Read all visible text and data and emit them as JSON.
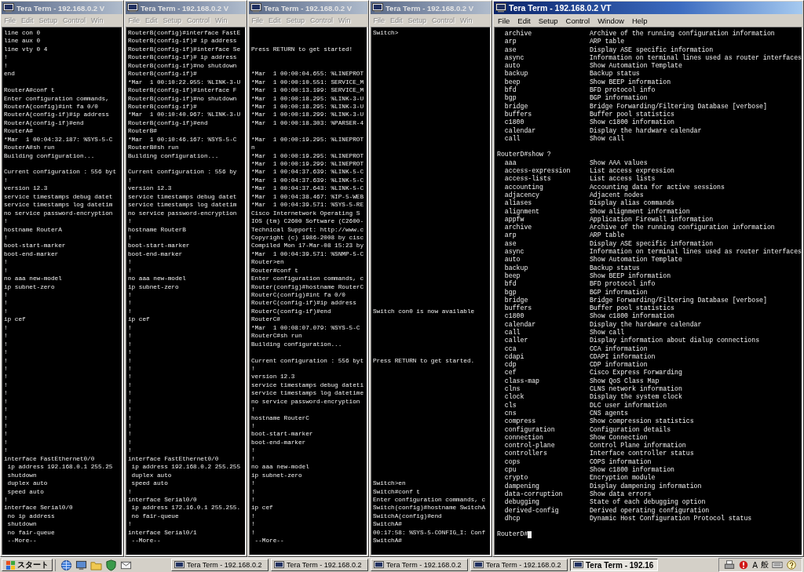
{
  "windows": [
    {
      "title": "Tera Term - 192.168.0.2 V",
      "active": false,
      "kind": "narrow",
      "menu": [
        "File",
        "Edit",
        "Setup",
        "Control",
        "Win"
      ],
      "lines": [
        {
          "kind": "text",
          "text": "line con 0"
        },
        {
          "kind": "text",
          "text": "line aux 0"
        },
        {
          "kind": "text",
          "text": "line vty 0 4"
        },
        {
          "kind": "text",
          "text": "!"
        },
        {
          "kind": "text",
          "text": "!"
        },
        {
          "kind": "text",
          "text": "end"
        },
        {
          "kind": "blank"
        },
        {
          "kind": "text",
          "text": "RouterA#conf t"
        },
        {
          "kind": "text",
          "text": "Enter configuration commands,"
        },
        {
          "kind": "text",
          "text": "RouterA(config)#int fa 0/0"
        },
        {
          "kind": "text",
          "text": "RouterA(config-if)#ip address"
        },
        {
          "kind": "text",
          "text": "RouterA(config-if)#end"
        },
        {
          "kind": "text",
          "text": "RouterA#"
        },
        {
          "kind": "text",
          "text": "*Mar  1 00:04:32.187: %SYS-5-C"
        },
        {
          "kind": "text",
          "text": "RouterA#sh run"
        },
        {
          "kind": "text",
          "text": "Building configuration..."
        },
        {
          "kind": "blank"
        },
        {
          "kind": "text",
          "text": "Current configuration : 556 byt"
        },
        {
          "kind": "text",
          "text": "!"
        },
        {
          "kind": "text",
          "text": "version 12.3"
        },
        {
          "kind": "text",
          "text": "service timestamps debug datet"
        },
        {
          "kind": "text",
          "text": "service timestamps log datetim"
        },
        {
          "kind": "text",
          "text": "no service password-encryption"
        },
        {
          "kind": "text",
          "text": "!"
        },
        {
          "kind": "text",
          "text": "hostname RouterA"
        },
        {
          "kind": "text",
          "text": "!"
        },
        {
          "kind": "text",
          "text": "boot-start-marker"
        },
        {
          "kind": "text",
          "text": "boot-end-marker"
        },
        {
          "kind": "text",
          "text": "!"
        },
        {
          "kind": "text",
          "text": "!"
        },
        {
          "kind": "text",
          "text": "no aaa new-model"
        },
        {
          "kind": "text",
          "text": "ip subnet-zero"
        },
        {
          "kind": "text",
          "text": "!"
        },
        {
          "kind": "text",
          "text": "!"
        },
        {
          "kind": "text",
          "text": "!"
        },
        {
          "kind": "text",
          "text": "ip cef"
        },
        {
          "kind": "text",
          "text": "!"
        },
        {
          "kind": "text",
          "text": "!"
        },
        {
          "kind": "text",
          "text": "!"
        },
        {
          "kind": "text",
          "text": "!"
        },
        {
          "kind": "text",
          "text": "!"
        },
        {
          "kind": "text",
          "text": "!"
        },
        {
          "kind": "text",
          "text": "!"
        },
        {
          "kind": "text",
          "text": "!"
        },
        {
          "kind": "text",
          "text": "!"
        },
        {
          "kind": "text",
          "text": "!"
        },
        {
          "kind": "text",
          "text": "!"
        },
        {
          "kind": "text",
          "text": "!"
        },
        {
          "kind": "text",
          "text": "!"
        },
        {
          "kind": "text",
          "text": "!"
        },
        {
          "kind": "text",
          "text": "!"
        },
        {
          "kind": "text",
          "text": "!"
        },
        {
          "kind": "text",
          "text": "interface FastEthernet0/0"
        },
        {
          "kind": "text",
          "text": " ip address 192.168.0.1 255.25"
        },
        {
          "kind": "text",
          "text": " shutdown"
        },
        {
          "kind": "text",
          "text": " duplex auto"
        },
        {
          "kind": "text",
          "text": " speed auto"
        },
        {
          "kind": "text",
          "text": "!"
        },
        {
          "kind": "text",
          "text": "interface Serial0/0"
        },
        {
          "kind": "text",
          "text": " no ip address"
        },
        {
          "kind": "text",
          "text": " shutdown"
        },
        {
          "kind": "text",
          "text": " no fair-queue"
        },
        {
          "kind": "text",
          "text": " --More--"
        }
      ]
    },
    {
      "title": "Tera Term - 192.168.0.2 V",
      "active": false,
      "kind": "narrow",
      "menu": [
        "File",
        "Edit",
        "Setup",
        "Control",
        "Win"
      ],
      "lines": [
        {
          "kind": "text",
          "text": "RouterB(config)#interface FastE"
        },
        {
          "kind": "text",
          "text": "RouterB(config-if)# ip address"
        },
        {
          "kind": "text",
          "text": "RouterB(config-if)#interface Se"
        },
        {
          "kind": "text",
          "text": "RouterB(config-if)# ip address"
        },
        {
          "kind": "text",
          "text": "RouterB(config-if)#no shutdown"
        },
        {
          "kind": "text",
          "text": "RouterB(config-if)#"
        },
        {
          "kind": "text",
          "text": "*Mar  1 00:10:22.955: %LINK-3-U"
        },
        {
          "kind": "text",
          "text": "RouterB(config-if)#interface F"
        },
        {
          "kind": "text",
          "text": "RouterB(config-if)#no shutdown"
        },
        {
          "kind": "text",
          "text": "RouterB(config-if)#"
        },
        {
          "kind": "text",
          "text": "*Mar  1 00:10:40.967: %LINK-3-U"
        },
        {
          "kind": "text",
          "text": "RouterB(config-if)#end"
        },
        {
          "kind": "text",
          "text": "RouterB#"
        },
        {
          "kind": "text",
          "text": "*Mar  1 00:10:46.167: %SYS-5-C"
        },
        {
          "kind": "text",
          "text": "RouterB#sh run"
        },
        {
          "kind": "text",
          "text": "Building configuration..."
        },
        {
          "kind": "blank"
        },
        {
          "kind": "text",
          "text": "Current configuration : 556 by"
        },
        {
          "kind": "text",
          "text": "!"
        },
        {
          "kind": "text",
          "text": "version 12.3"
        },
        {
          "kind": "text",
          "text": "service timestamps debug datet"
        },
        {
          "kind": "text",
          "text": "service timestamps log datetim"
        },
        {
          "kind": "text",
          "text": "no service password-encryption"
        },
        {
          "kind": "text",
          "text": "!"
        },
        {
          "kind": "text",
          "text": "hostname RouterB"
        },
        {
          "kind": "text",
          "text": "!"
        },
        {
          "kind": "text",
          "text": "boot-start-marker"
        },
        {
          "kind": "text",
          "text": "boot-end-marker"
        },
        {
          "kind": "text",
          "text": "!"
        },
        {
          "kind": "text",
          "text": "!"
        },
        {
          "kind": "text",
          "text": "no aaa new-model"
        },
        {
          "kind": "text",
          "text": "ip subnet-zero"
        },
        {
          "kind": "text",
          "text": "!"
        },
        {
          "kind": "text",
          "text": "!"
        },
        {
          "kind": "text",
          "text": "!"
        },
        {
          "kind": "text",
          "text": "ip cef"
        },
        {
          "kind": "text",
          "text": "!"
        },
        {
          "kind": "text",
          "text": "!"
        },
        {
          "kind": "text",
          "text": "!"
        },
        {
          "kind": "text",
          "text": "!"
        },
        {
          "kind": "text",
          "text": "!"
        },
        {
          "kind": "text",
          "text": "!"
        },
        {
          "kind": "text",
          "text": "!"
        },
        {
          "kind": "text",
          "text": "!"
        },
        {
          "kind": "text",
          "text": "!"
        },
        {
          "kind": "text",
          "text": "!"
        },
        {
          "kind": "text",
          "text": "!"
        },
        {
          "kind": "text",
          "text": "!"
        },
        {
          "kind": "text",
          "text": "!"
        },
        {
          "kind": "text",
          "text": "!"
        },
        {
          "kind": "text",
          "text": "!"
        },
        {
          "kind": "text",
          "text": "!"
        },
        {
          "kind": "text",
          "text": "interface FastEthernet0/0"
        },
        {
          "kind": "text",
          "text": " ip address 192.168.0.2 255.255"
        },
        {
          "kind": "text",
          "text": " duplex auto"
        },
        {
          "kind": "text",
          "text": " speed auto"
        },
        {
          "kind": "text",
          "text": "!"
        },
        {
          "kind": "text",
          "text": "interface Serial0/0"
        },
        {
          "kind": "text",
          "text": " ip address 172.16.0.1 255.255."
        },
        {
          "kind": "text",
          "text": " no fair-queue"
        },
        {
          "kind": "text",
          "text": "!"
        },
        {
          "kind": "text",
          "text": "interface Serial0/1"
        },
        {
          "kind": "text",
          "text": " --More--"
        }
      ]
    },
    {
      "title": "Tera Term - 192.168.0.2 V",
      "active": false,
      "kind": "narrow",
      "menu": [
        "File",
        "Edit",
        "Setup",
        "Control",
        "Win"
      ],
      "lines": [
        {
          "kind": "blank"
        },
        {
          "kind": "blank"
        },
        {
          "kind": "text",
          "text": "Press RETURN to get started!"
        },
        {
          "kind": "blank"
        },
        {
          "kind": "blank"
        },
        {
          "kind": "text",
          "text": "*Mar  1 00:00:04.655: %LINEPROT"
        },
        {
          "kind": "text",
          "text": "*Mar  1 00:00:10.551: SERVICE_M"
        },
        {
          "kind": "text",
          "text": "*Mar  1 00:00:13.199: SERVICE_M"
        },
        {
          "kind": "text",
          "text": "*Mar  1 00:00:18.295: %LINK-3-U"
        },
        {
          "kind": "text",
          "text": "*Mar  1 00:00:18.295: %LINK-3-U"
        },
        {
          "kind": "text",
          "text": "*Mar  1 00:00:18.299: %LINK-3-U"
        },
        {
          "kind": "text",
          "text": "*Mar  1 00:00:18.303: %PARSER-4"
        },
        {
          "kind": "blank"
        },
        {
          "kind": "text",
          "text": "*Mar  1 00:00:19.295: %LINEPROT"
        },
        {
          "kind": "text",
          "text": "n"
        },
        {
          "kind": "text",
          "text": "*Mar  1 00:00:19.295: %LINEPROT"
        },
        {
          "kind": "text",
          "text": "*Mar  1 00:00:19.299: %LINEPROT"
        },
        {
          "kind": "text",
          "text": "*Mar  1 00:04:37.639: %LINK-5-C"
        },
        {
          "kind": "text",
          "text": "*Mar  1 00:04:37.639: %LINK-5-C"
        },
        {
          "kind": "text",
          "text": "*Mar  1 00:04:37.643: %LINK-5-C"
        },
        {
          "kind": "text",
          "text": "*Mar  1 00:04:38.467: %IP-5-WEB"
        },
        {
          "kind": "text",
          "text": "*Mar  1 00:04:39.571: %SYS-5-RE"
        },
        {
          "kind": "text",
          "text": "Cisco Internetwork Operating S"
        },
        {
          "kind": "text",
          "text": "IOS (tm) C2600 Software (C2600-"
        },
        {
          "kind": "text",
          "text": "Technical Support: http://www.c"
        },
        {
          "kind": "text",
          "text": "Copyright (c) 1986-2008 by cisc"
        },
        {
          "kind": "text",
          "text": "Compiled Mon 17-Mar-08 15:23 by"
        },
        {
          "kind": "text",
          "text": "*Mar  1 00:04:39.571: %SNMP-5-C"
        },
        {
          "kind": "text",
          "text": "Router>en"
        },
        {
          "kind": "text",
          "text": "Router#conf t"
        },
        {
          "kind": "text",
          "text": "Enter configuration commands, c"
        },
        {
          "kind": "text",
          "text": "Router(config)#hostname RouterC"
        },
        {
          "kind": "text",
          "text": "RouterC(config)#int fa 0/0"
        },
        {
          "kind": "text",
          "text": "RouterC(config-if)#ip address"
        },
        {
          "kind": "text",
          "text": "RouterC(config-if)#end"
        },
        {
          "kind": "text",
          "text": "RouterC#"
        },
        {
          "kind": "text",
          "text": "*Mar  1 00:08:07.079: %SYS-5-C"
        },
        {
          "kind": "text",
          "text": "RouterC#sh run"
        },
        {
          "kind": "text",
          "text": "Building configuration..."
        },
        {
          "kind": "blank"
        },
        {
          "kind": "text",
          "text": "Current configuration : 556 byt"
        },
        {
          "kind": "text",
          "text": "!"
        },
        {
          "kind": "text",
          "text": "version 12.3"
        },
        {
          "kind": "text",
          "text": "service timestamps debug dateti"
        },
        {
          "kind": "text",
          "text": "service timestamps log datetime"
        },
        {
          "kind": "text",
          "text": "no service password-encryption"
        },
        {
          "kind": "text",
          "text": "!"
        },
        {
          "kind": "text",
          "text": "hostname RouterC"
        },
        {
          "kind": "text",
          "text": "!"
        },
        {
          "kind": "text",
          "text": "boot-start-marker"
        },
        {
          "kind": "text",
          "text": "boot-end-marker"
        },
        {
          "kind": "text",
          "text": "!"
        },
        {
          "kind": "text",
          "text": "!"
        },
        {
          "kind": "text",
          "text": "no aaa new-model"
        },
        {
          "kind": "text",
          "text": "ip subnet-zero"
        },
        {
          "kind": "text",
          "text": "!"
        },
        {
          "kind": "text",
          "text": "!"
        },
        {
          "kind": "text",
          "text": "!"
        },
        {
          "kind": "text",
          "text": "ip cef"
        },
        {
          "kind": "text",
          "text": "!"
        },
        {
          "kind": "text",
          "text": "!"
        },
        {
          "kind": "text",
          "text": "!"
        },
        {
          "kind": "text",
          "text": " --More--"
        }
      ]
    },
    {
      "title": "Tera Term - 192.168.0.2 V",
      "active": false,
      "kind": "narrow",
      "menu": [
        "File",
        "Edit",
        "Setup",
        "Control",
        "Win"
      ],
      "lines": [
        {
          "kind": "text",
          "text": "Switch>"
        },
        {
          "kind": "blank"
        },
        {
          "kind": "blank"
        },
        {
          "kind": "blank"
        },
        {
          "kind": "blank"
        },
        {
          "kind": "blank"
        },
        {
          "kind": "blank"
        },
        {
          "kind": "blank"
        },
        {
          "kind": "blank"
        },
        {
          "kind": "blank"
        },
        {
          "kind": "blank"
        },
        {
          "kind": "blank"
        },
        {
          "kind": "blank"
        },
        {
          "kind": "blank"
        },
        {
          "kind": "blank"
        },
        {
          "kind": "blank"
        },
        {
          "kind": "blank"
        },
        {
          "kind": "blank"
        },
        {
          "kind": "blank"
        },
        {
          "kind": "blank"
        },
        {
          "kind": "blank"
        },
        {
          "kind": "blank"
        },
        {
          "kind": "blank"
        },
        {
          "kind": "blank"
        },
        {
          "kind": "blank"
        },
        {
          "kind": "blank"
        },
        {
          "kind": "blank"
        },
        {
          "kind": "blank"
        },
        {
          "kind": "blank"
        },
        {
          "kind": "blank"
        },
        {
          "kind": "blank"
        },
        {
          "kind": "blank"
        },
        {
          "kind": "blank"
        },
        {
          "kind": "blank"
        },
        {
          "kind": "text",
          "text": "Switch con0 is now available"
        },
        {
          "kind": "blank"
        },
        {
          "kind": "blank"
        },
        {
          "kind": "blank"
        },
        {
          "kind": "blank"
        },
        {
          "kind": "blank"
        },
        {
          "kind": "text",
          "text": "Press RETURN to get started."
        },
        {
          "kind": "blank"
        },
        {
          "kind": "blank"
        },
        {
          "kind": "blank"
        },
        {
          "kind": "blank"
        },
        {
          "kind": "blank"
        },
        {
          "kind": "blank"
        },
        {
          "kind": "blank"
        },
        {
          "kind": "blank"
        },
        {
          "kind": "blank"
        },
        {
          "kind": "blank"
        },
        {
          "kind": "blank"
        },
        {
          "kind": "blank"
        },
        {
          "kind": "blank"
        },
        {
          "kind": "blank"
        },
        {
          "kind": "text",
          "text": "Switch>en"
        },
        {
          "kind": "text",
          "text": "Switch#conf t"
        },
        {
          "kind": "text",
          "text": "Enter configuration commands, c"
        },
        {
          "kind": "text",
          "text": "Switch(config)#hostname SwitchA"
        },
        {
          "kind": "text",
          "text": "SwitchA(config)#end"
        },
        {
          "kind": "text",
          "text": "SwitchA#"
        },
        {
          "kind": "text",
          "text": "00:17:58: %SYS-5-CONFIG_I: Conf"
        },
        {
          "kind": "text",
          "text": "SwitchA#"
        }
      ]
    },
    {
      "title": "Tera Term - 192.168.0.2 VT",
      "active": true,
      "kind": "wide",
      "menu": [
        "File",
        "Edit",
        "Setup",
        "Control",
        "Window",
        "Help"
      ],
      "lines": [
        {
          "kind": "command",
          "command": "archive",
          "description": "Archive of the running configuration information"
        },
        {
          "kind": "command",
          "command": "arp",
          "description": "ARP table"
        },
        {
          "kind": "command",
          "command": "ase",
          "description": "Display ASE specific information"
        },
        {
          "kind": "command",
          "command": "async",
          "description": "Information on terminal lines used as router interfaces"
        },
        {
          "kind": "command",
          "command": "auto",
          "description": "Show Automation Template"
        },
        {
          "kind": "command",
          "command": "backup",
          "description": "Backup status"
        },
        {
          "kind": "command",
          "command": "beep",
          "description": "Show BEEP information"
        },
        {
          "kind": "command",
          "command": "bfd",
          "description": "BFD protocol info"
        },
        {
          "kind": "command",
          "command": "bgp",
          "description": "BGP information"
        },
        {
          "kind": "command",
          "command": "bridge",
          "description": "Bridge Forwarding/Filtering Database [verbose]"
        },
        {
          "kind": "command",
          "command": "buffers",
          "description": "Buffer pool statistics"
        },
        {
          "kind": "command",
          "command": "c1800",
          "description": "Show c1800 information"
        },
        {
          "kind": "command",
          "command": "calendar",
          "description": "Display the hardware calendar"
        },
        {
          "kind": "command",
          "command": "call",
          "description": "Show call"
        },
        {
          "kind": "blank"
        },
        {
          "kind": "text",
          "text": "RouterD#show ?"
        },
        {
          "kind": "command",
          "command": "aaa",
          "description": "Show AAA values"
        },
        {
          "kind": "command",
          "command": "access-expression",
          "description": "List access expression"
        },
        {
          "kind": "command",
          "command": "access-lists",
          "description": "List access lists"
        },
        {
          "kind": "command",
          "command": "accounting",
          "description": "Accounting data for active sessions"
        },
        {
          "kind": "command",
          "command": "adjacency",
          "description": "Adjacent nodes"
        },
        {
          "kind": "command",
          "command": "aliases",
          "description": "Display alias commands"
        },
        {
          "kind": "command",
          "command": "alignment",
          "description": "Show alignment information"
        },
        {
          "kind": "command",
          "command": "appfw",
          "description": "Application Firewall information"
        },
        {
          "kind": "command",
          "command": "archive",
          "description": "Archive of the running configuration information"
        },
        {
          "kind": "command",
          "command": "arp",
          "description": "ARP table"
        },
        {
          "kind": "command",
          "command": "ase",
          "description": "Display ASE specific information"
        },
        {
          "kind": "command",
          "command": "async",
          "description": "Information on terminal lines used as router interfaces"
        },
        {
          "kind": "command",
          "command": "auto",
          "description": "Show Automation Template"
        },
        {
          "kind": "command",
          "command": "backup",
          "description": "Backup status"
        },
        {
          "kind": "command",
          "command": "beep",
          "description": "Show BEEP information"
        },
        {
          "kind": "command",
          "command": "bfd",
          "description": "BFD protocol info"
        },
        {
          "kind": "command",
          "command": "bgp",
          "description": "BGP information"
        },
        {
          "kind": "command",
          "command": "bridge",
          "description": "Bridge Forwarding/Filtering Database [verbose]"
        },
        {
          "kind": "command",
          "command": "buffers",
          "description": "Buffer pool statistics"
        },
        {
          "kind": "command",
          "command": "c1800",
          "description": "Show c1800 information"
        },
        {
          "kind": "command",
          "command": "calendar",
          "description": "Display the hardware calendar"
        },
        {
          "kind": "command",
          "command": "call",
          "description": "Show call"
        },
        {
          "kind": "command",
          "command": "caller",
          "description": "Display information about dialup connections"
        },
        {
          "kind": "command",
          "command": "cca",
          "description": "CCA information"
        },
        {
          "kind": "command",
          "command": "cdapi",
          "description": "CDAPI information"
        },
        {
          "kind": "command",
          "command": "cdp",
          "description": "CDP information"
        },
        {
          "kind": "command",
          "command": "cef",
          "description": "Cisco Express Forwarding"
        },
        {
          "kind": "command",
          "command": "class-map",
          "description": "Show QoS Class Map"
        },
        {
          "kind": "command",
          "command": "clns",
          "description": "CLNS network information"
        },
        {
          "kind": "command",
          "command": "clock",
          "description": "Display the system clock"
        },
        {
          "kind": "command",
          "command": "cls",
          "description": "DLC user information"
        },
        {
          "kind": "command",
          "command": "cns",
          "description": "CNS agents"
        },
        {
          "kind": "command",
          "command": "compress",
          "description": "Show compression statistics"
        },
        {
          "kind": "command",
          "command": "configuration",
          "description": "Configuration details"
        },
        {
          "kind": "command",
          "command": "connection",
          "description": "Show Connection"
        },
        {
          "kind": "command",
          "command": "control-plane",
          "description": "Control Plane information"
        },
        {
          "kind": "command",
          "command": "controllers",
          "description": "Interface controller status"
        },
        {
          "kind": "command",
          "command": "cops",
          "description": "COPS information"
        },
        {
          "kind": "command",
          "command": "cpu",
          "description": "Show c1800 information"
        },
        {
          "kind": "command",
          "command": "crypto",
          "description": "Encryption module"
        },
        {
          "kind": "command",
          "command": "dampening",
          "description": "Display dampening information"
        },
        {
          "kind": "command",
          "command": "data-corruption",
          "description": "Show data errors"
        },
        {
          "kind": "command",
          "command": "debugging",
          "description": "State of each debugging option"
        },
        {
          "kind": "command",
          "command": "derived-config",
          "description": "Derived operating configuration"
        },
        {
          "kind": "command",
          "command": "dhcp",
          "description": "Dynamic Host Configuration Protocol status"
        },
        {
          "kind": "blank"
        },
        {
          "kind": "text",
          "text": "RouterD#",
          "cursor": true
        }
      ]
    }
  ],
  "taskbar": {
    "start": "スタート",
    "tasks": [
      {
        "label": "Tera Term - 192.168.0.2",
        "selected": false
      },
      {
        "label": "Tera Term - 192.168.0.2",
        "selected": false
      },
      {
        "label": "Tera Term - 192.168.0.2",
        "selected": false
      },
      {
        "label": "Tera Term - 192.168.0.2",
        "selected": false
      },
      {
        "label": "Tera Term - 192.16",
        "selected": true
      }
    ],
    "tray": [
      "A",
      "般"
    ]
  }
}
